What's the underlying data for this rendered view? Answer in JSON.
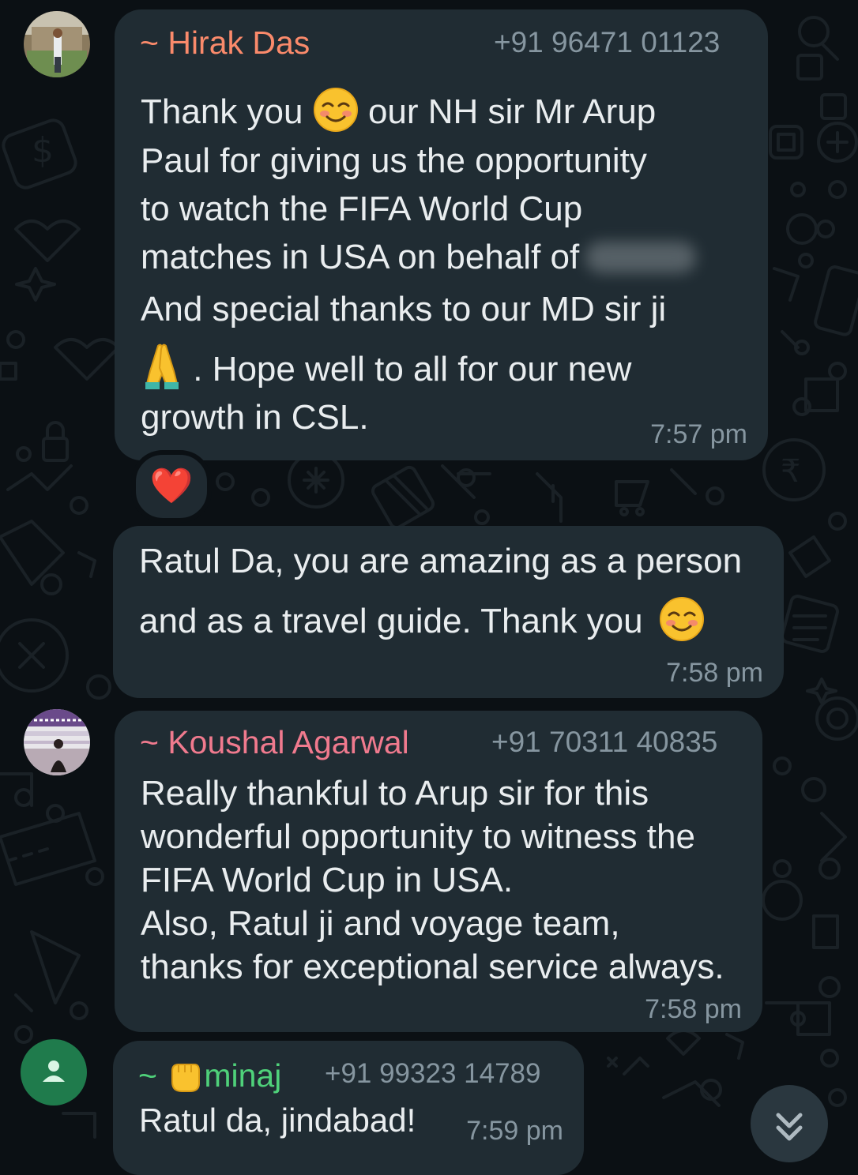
{
  "messages": [
    {
      "sender": "~ Hirak Das",
      "phone": "+91 96471 01123",
      "lines": [
        "Thank you",
        "our NH sir Mr Arup",
        "Paul for giving us the opportunity",
        "to watch the FIFA World Cup",
        "matches in USA on behalf of",
        "And special thanks to our MD sir ji",
        ". Hope well to all for our new",
        "growth in CSL."
      ],
      "time": "7:57 pm",
      "reaction": "❤️",
      "sender_color": "#fa8a6b"
    },
    {
      "lines": [
        "Ratul Da, you are amazing as a person",
        "and as a travel guide. Thank you"
      ],
      "time": "7:58 pm"
    },
    {
      "sender": "~ Koushal Agarwal",
      "phone": "+91 70311 40835",
      "lines": [
        "Really thankful to Arup sir for this",
        "wonderful opportunity to witness the",
        "FIFA World Cup in USA.",
        "Also, Ratul ji and voyage team,",
        "thanks for exceptional service always."
      ],
      "time": "7:58 pm",
      "sender_color": "#f07a8e"
    },
    {
      "sender_prefix": "~",
      "sender": "minaj",
      "phone": "+91 99323 14789",
      "lines": [
        "Ratul da, jindabad!"
      ],
      "time": "7:59 pm",
      "sender_color": "#4fd17a"
    }
  ],
  "icons": {
    "default_avatar": "person-icon",
    "scroll_down": "chevron-double-down-icon"
  },
  "colors": {
    "bubble": "#202c33",
    "background": "#0b1014",
    "meta_text": "#8696a0",
    "default_avatar_bg": "#1f7b4c"
  }
}
